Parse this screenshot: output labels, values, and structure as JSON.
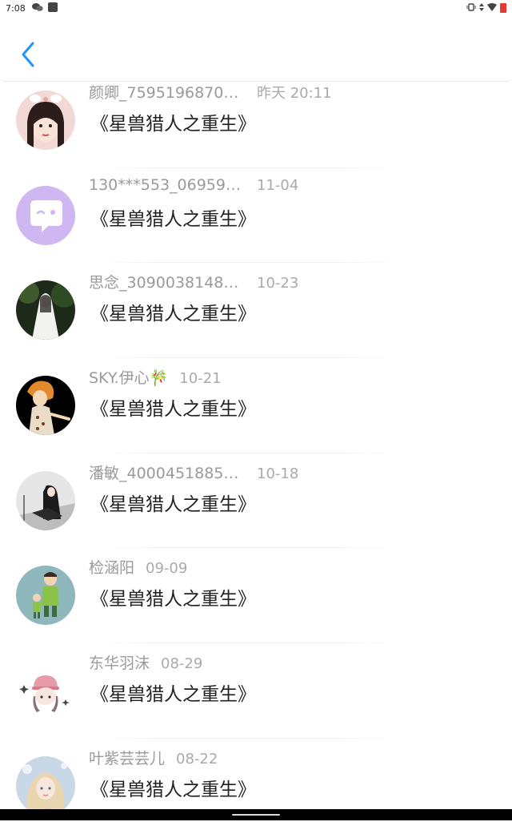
{
  "status_bar": {
    "time": "7:08",
    "icons": [
      "wechat-icon",
      "notification-icon"
    ],
    "right_icons": [
      "vibrate-icon",
      "data-arrows-icon",
      "wifi-icon",
      "battery-icon"
    ]
  },
  "header": {
    "back_icon": "chevron-left-icon",
    "accent_color": "#2196f3"
  },
  "items": [
    {
      "name": "颜卿_75951968702...",
      "time": "昨天 20:11",
      "title": "《星兽猎人之重生》",
      "avatar": "girl-with-bow"
    },
    {
      "name": "130***553_069593...",
      "time": "11-04",
      "title": "《星兽猎人之重生》",
      "avatar": "chat-bubble-default"
    },
    {
      "name": "思念_30900381482...",
      "time": "10-23",
      "title": "《星兽猎人之重生》",
      "avatar": "white-robe-figure"
    },
    {
      "name": "SKY.伊心🎋",
      "time": "10-21",
      "title": "《星兽猎人之重生》",
      "avatar": "orange-hair-character"
    },
    {
      "name": "潘敏_40004518859...",
      "time": "10-18",
      "title": "《星兽猎人之重生》",
      "avatar": "dark-hair-girl"
    },
    {
      "name": "检涵阳",
      "time": "09-09",
      "title": "《星兽猎人之重生》",
      "avatar": "father-son-cartoon"
    },
    {
      "name": "东华羽沫",
      "time": "08-29",
      "title": "《星兽猎人之重生》",
      "avatar": "pink-hat-girl"
    },
    {
      "name": "叶紫芸芸儿",
      "time": "08-22",
      "title": "《星兽猎人之重生》",
      "avatar": "blonde-fantasy-girl"
    }
  ]
}
